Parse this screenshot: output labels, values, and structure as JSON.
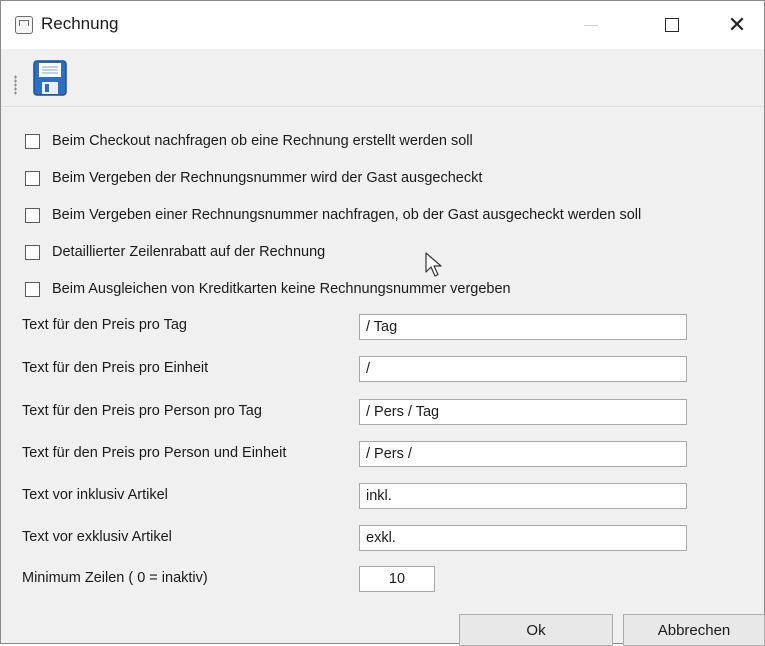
{
  "window": {
    "title": "Rechnung",
    "close_glyph": "✕"
  },
  "toolbar": {
    "save_icon": "floppy-disk-icon"
  },
  "checkboxes": [
    {
      "label": "Beim Checkout nachfragen ob eine Rechnung erstellt werden soll",
      "checked": false
    },
    {
      "label": "Beim Vergeben der Rechnungsnummer wird der Gast ausgecheckt",
      "checked": false
    },
    {
      "label": "Beim Vergeben einer Rechnungsnummer nachfragen, ob der Gast ausgecheckt werden soll",
      "checked": false
    },
    {
      "label": "Detaillierter Zeilenrabatt auf der Rechnung",
      "checked": false
    },
    {
      "label": "Beim Ausgleichen von Kreditkarten keine Rechnungsnummer vergeben",
      "checked": false
    }
  ],
  "fields": [
    {
      "label": "Text für den Preis pro Tag",
      "value": "/ Tag"
    },
    {
      "label": "Text für den Preis pro Einheit",
      "value": "/"
    },
    {
      "label": "Text für den Preis pro Person pro Tag",
      "value": "/ Pers / Tag"
    },
    {
      "label": "Text für den Preis pro Person und Einheit",
      "value": "/ Pers /"
    },
    {
      "label": "Text vor inklusiv Artikel",
      "value": "inkl."
    },
    {
      "label": "Text vor exklusiv Artikel",
      "value": "exkl."
    }
  ],
  "min_rows": {
    "label": "Minimum Zeilen ( 0 = inaktiv)",
    "value": "10"
  },
  "buttons": {
    "ok": "Ok",
    "cancel": "Abbrechen"
  }
}
